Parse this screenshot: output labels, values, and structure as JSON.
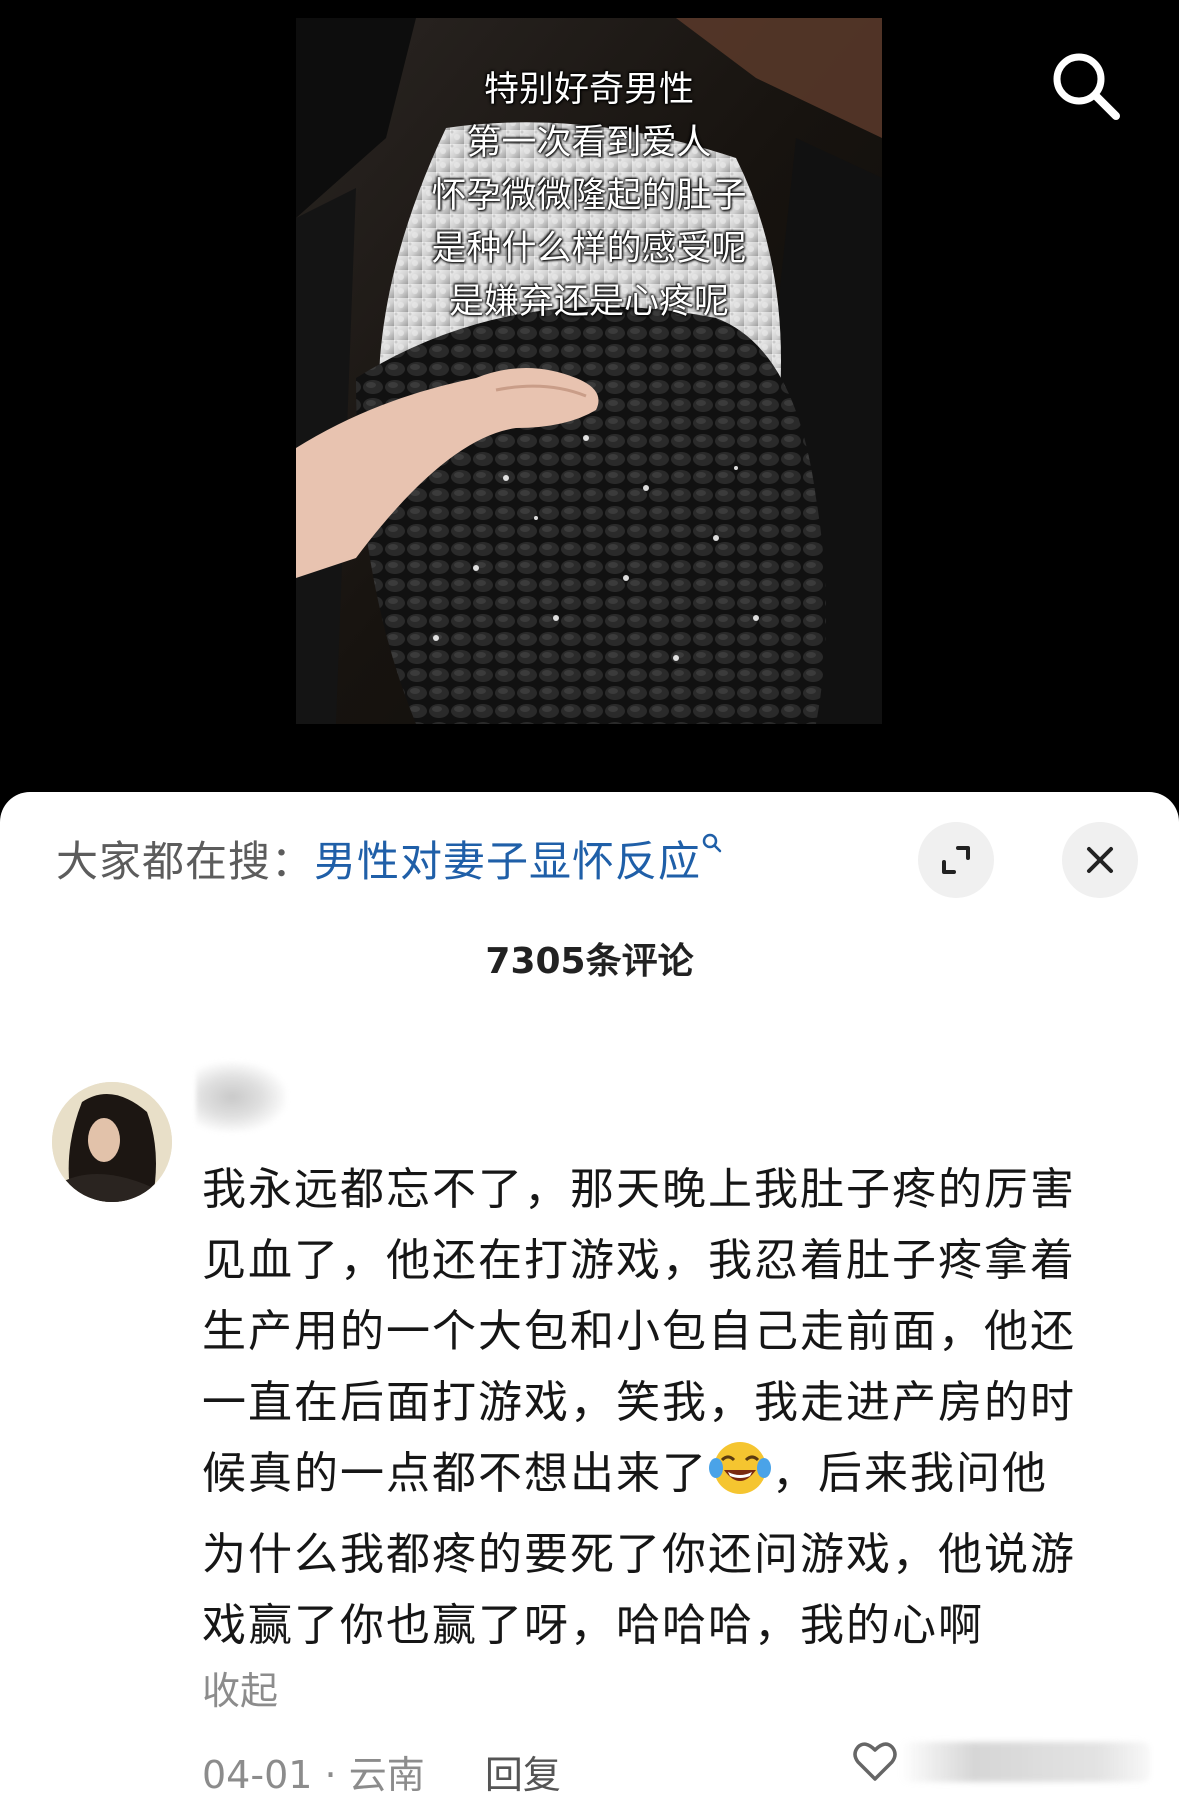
{
  "video": {
    "caption_lines": [
      "特别好奇男性",
      "第一次看到爱人",
      "怀孕微微隆起的肚子",
      "是种什么样的感受呢",
      "是嫌弃还是心疼呢"
    ],
    "search_icon": "search-icon"
  },
  "panel": {
    "suggest_prefix": "大家都在搜：",
    "suggest_query": "男性对妻子显怀反应",
    "suggest_icon": "search-icon",
    "expand_icon": "expand-icon",
    "close_icon": "close-icon",
    "comment_count": "7305条评论"
  },
  "comment": {
    "lines": [
      "我永远都忘不了，那天晚上我肚子疼的厉害",
      "见血了，他还在打游戏，我忍着肚子疼拿着",
      "生产用的一个大包和小包自己走前面，他还",
      "一直在后面打游戏，笑我，我走进产房的时",
      "候真的一点都不想出来了",
      "，后来我问他",
      "为什么我都疼的要死了你还问游戏，他说游",
      "戏赢了你也赢了呀，哈哈哈，我的心啊"
    ],
    "emoji": "laughing-crying-emoji",
    "collapse_label": "收起",
    "date": "04-01",
    "separator": "·",
    "location": "云南",
    "reply_label": "回复",
    "like_icon": "heart-icon"
  },
  "colors": {
    "link": "#1f5fa8",
    "muted": "#8c8c8c",
    "text": "#161616"
  }
}
